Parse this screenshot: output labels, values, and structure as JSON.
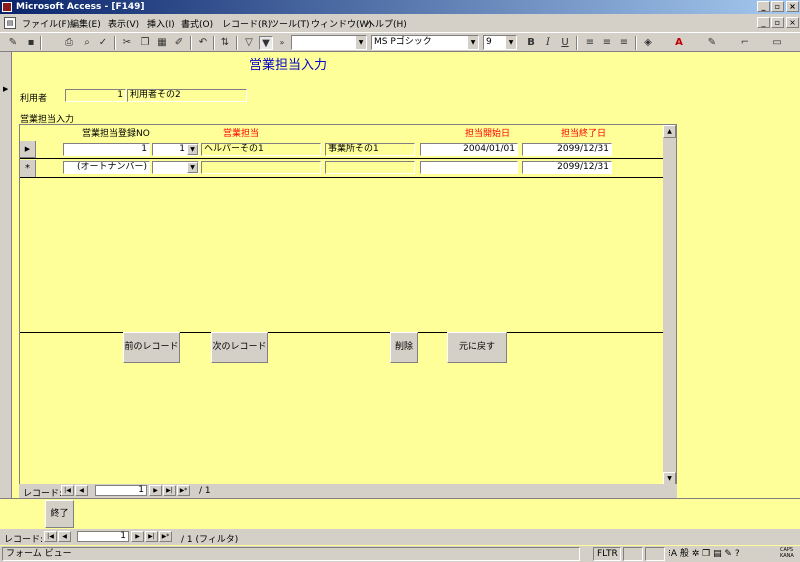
{
  "window": {
    "title": "Microsoft Access - [F149]"
  },
  "menu": [
    "ファイル(F)",
    "編集(E)",
    "表示(V)",
    "挿入(I)",
    "書式(O)",
    "レコード(R)",
    "ツール(T)",
    "ウィンドウ(W)",
    "ヘルプ(H)"
  ],
  "toolbar": {
    "font_name": "MS Pゴシック",
    "font_size": "9"
  },
  "form": {
    "title": "営業担当入力",
    "user_label": "利用者",
    "user_id": "1",
    "user_name": "利用者その2",
    "subform_label": "営業担当入力",
    "columns": {
      "reg_no": "営業担当登録NO",
      "sales": "営業担当",
      "start_date": "担当開始日",
      "end_date": "担当終了日"
    },
    "rows": [
      {
        "reg_no": "1",
        "combo": "1",
        "sales": "ヘルパーその1",
        "office": "事業所その1",
        "start_date": "2004/01/01",
        "end_date": "2099/12/31"
      },
      {
        "reg_no": "(オートナンバー)",
        "combo": "",
        "sales": "",
        "office": "",
        "start_date": "",
        "end_date": "2099/12/31"
      }
    ],
    "row_markers": {
      "current": "▶",
      "new": "*"
    },
    "buttons": {
      "prev": "前のレコード",
      "next": "次のレコード",
      "delete": "削除",
      "undo": "元に戻す",
      "exit": "終了"
    }
  },
  "subnav": {
    "label": "レコード:",
    "current": "1",
    "total": "/ 1"
  },
  "mainnav": {
    "label": "レコード:",
    "current": "1",
    "total": "/ 1 (フィルタ)"
  },
  "status": {
    "view": "フォーム ビュー",
    "fltr": "FLTR",
    "caps": "CAPS",
    "kana": "KANA"
  }
}
